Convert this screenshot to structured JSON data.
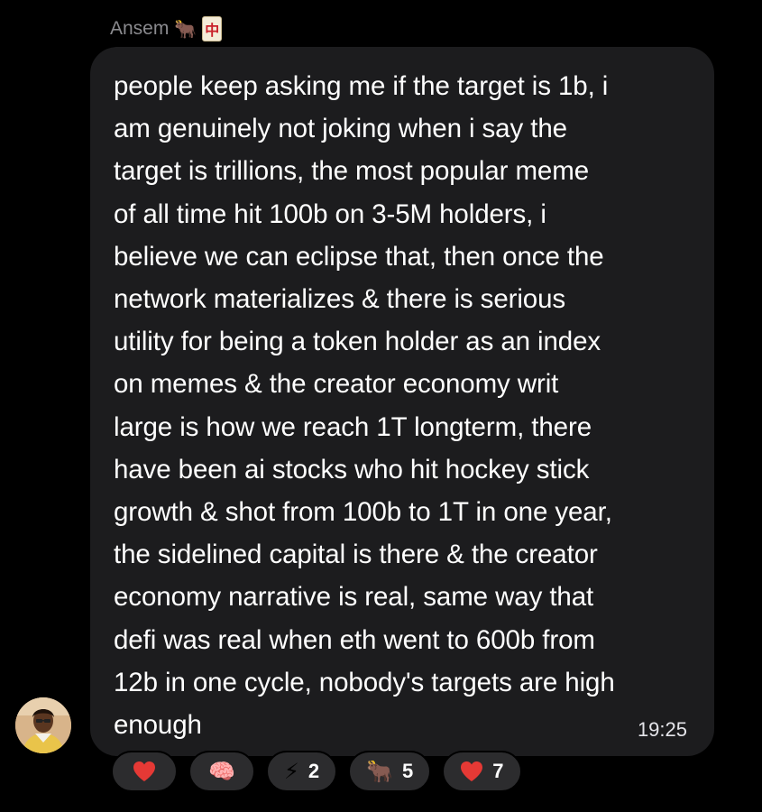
{
  "sender": {
    "name": "Ansem",
    "badges": [
      "🐂",
      "中"
    ]
  },
  "message": {
    "lines": [
      "people keep asking me if the target is 1b, i",
      "am genuinely not joking when i say the",
      "target is trillions, the most popular meme",
      "of all time hit 100b on 3-5M holders, i",
      "believe we can eclipse that, then once the",
      "network materializes & there is serious",
      "utility for being a token holder as an index",
      "on memes & the creator economy writ",
      "large is how we reach 1T longterm, there",
      "have been ai stocks who hit hockey stick",
      "growth & shot from 100b to 1T in one year,",
      "the sidelined capital is there & the creator",
      "economy narrative is real, same way that",
      "defi was real when eth went to 600b from",
      "12b in one cycle, nobody's targets are high",
      "enough"
    ],
    "timestamp": "19:25"
  },
  "reactions": [
    {
      "icon": "heart-icon",
      "emoji": "❤️",
      "count": ""
    },
    {
      "icon": "brain-icon",
      "emoji": "🧠",
      "count": ""
    },
    {
      "icon": "lightning-icon",
      "emoji": "⚡",
      "count": "2"
    },
    {
      "icon": "ox-icon",
      "emoji": "🐂",
      "count": "5"
    },
    {
      "icon": "heart-icon",
      "emoji": "❤️",
      "count": "7"
    }
  ],
  "colors": {
    "background": "#000000",
    "bubble": "#1c1c1e",
    "reaction_pill": "#2c2c2e",
    "sender_name": "#8a8a8e",
    "text": "#ffffff",
    "heart": "#e53935"
  }
}
